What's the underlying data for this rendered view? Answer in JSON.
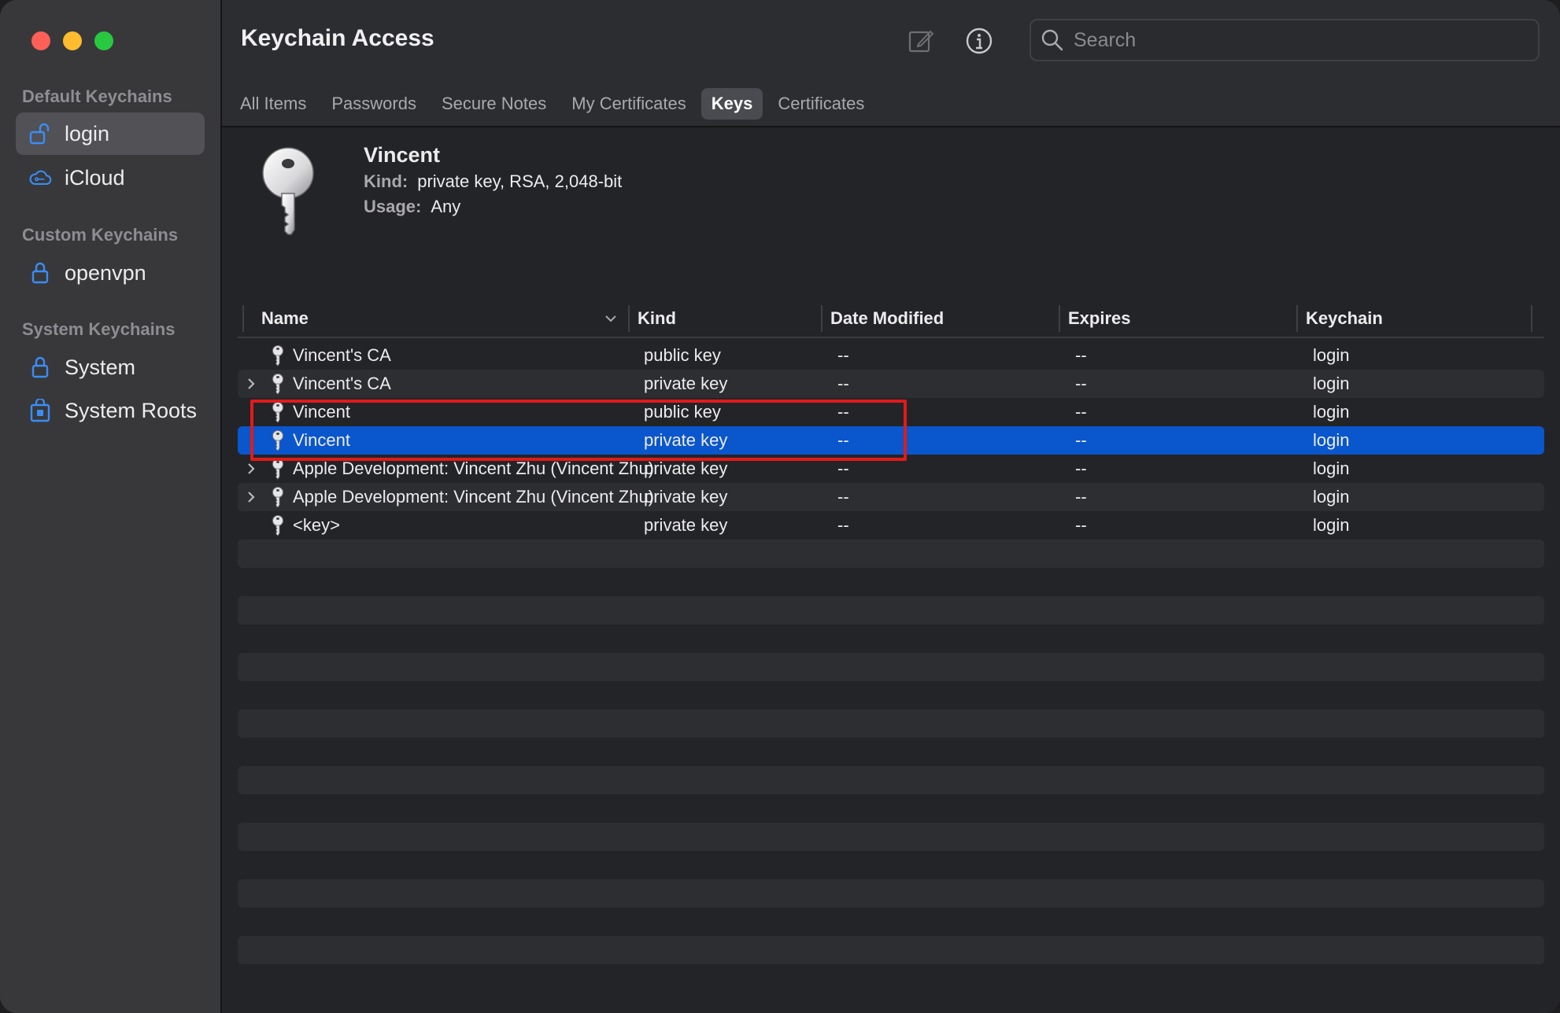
{
  "app": {
    "title": "Keychain Access"
  },
  "colors": {
    "accent": "#0a56cc",
    "highlight": "#e11a1a",
    "close": "#fe5f57",
    "minimize": "#febc2e",
    "zoom": "#28c840"
  },
  "sidebar": {
    "sections": [
      {
        "label": "Default Keychains",
        "items": [
          {
            "label": "login",
            "icon": "unlocked-lock-icon",
            "selected": true
          },
          {
            "label": "iCloud",
            "icon": "icloud-icon",
            "selected": false
          }
        ]
      },
      {
        "label": "Custom Keychains",
        "items": [
          {
            "label": "openvpn",
            "icon": "lock-icon",
            "selected": false
          }
        ]
      },
      {
        "label": "System Keychains",
        "items": [
          {
            "label": "System",
            "icon": "lock-icon",
            "selected": false
          },
          {
            "label": "System Roots",
            "icon": "cabinet-lock-icon",
            "selected": false
          }
        ]
      }
    ]
  },
  "toolbar": {
    "compose_icon": "compose-icon",
    "info_icon": "info-icon",
    "search_placeholder": "Search"
  },
  "tabs": [
    {
      "label": "All Items",
      "active": false
    },
    {
      "label": "Passwords",
      "active": false
    },
    {
      "label": "Secure Notes",
      "active": false
    },
    {
      "label": "My Certificates",
      "active": false
    },
    {
      "label": "Keys",
      "active": true
    },
    {
      "label": "Certificates",
      "active": false
    }
  ],
  "detail": {
    "name": "Vincent",
    "kind_label": "Kind:",
    "kind_value": "private key, RSA, 2,048-bit",
    "usage_label": "Usage:",
    "usage_value": "Any"
  },
  "table": {
    "columns": [
      "Name",
      "Kind",
      "Date Modified",
      "Expires",
      "Keychain"
    ],
    "rows": [
      {
        "name": "Vincent's CA",
        "kind": "public key",
        "modified": "--",
        "expires": "--",
        "keychain": "login",
        "expandable": false,
        "selected": false
      },
      {
        "name": "Vincent's CA",
        "kind": "private key",
        "modified": "--",
        "expires": "--",
        "keychain": "login",
        "expandable": true,
        "selected": false
      },
      {
        "name": "Vincent",
        "kind": "public key",
        "modified": "--",
        "expires": "--",
        "keychain": "login",
        "expandable": false,
        "selected": false
      },
      {
        "name": "Vincent",
        "kind": "private key",
        "modified": "--",
        "expires": "--",
        "keychain": "login",
        "expandable": false,
        "selected": true
      },
      {
        "name": "Apple Development: Vincent Zhu (Vincent Zhu)",
        "kind": "private key",
        "modified": "--",
        "expires": "--",
        "keychain": "login",
        "expandable": true,
        "selected": false
      },
      {
        "name": "Apple Development: Vincent Zhu (Vincent Zhu)",
        "kind": "private key",
        "modified": "--",
        "expires": "--",
        "keychain": "login",
        "expandable": true,
        "selected": false
      },
      {
        "name": "<key>",
        "kind": "private key",
        "modified": "--",
        "expires": "--",
        "keychain": "login",
        "expandable": false,
        "selected": false
      }
    ]
  }
}
